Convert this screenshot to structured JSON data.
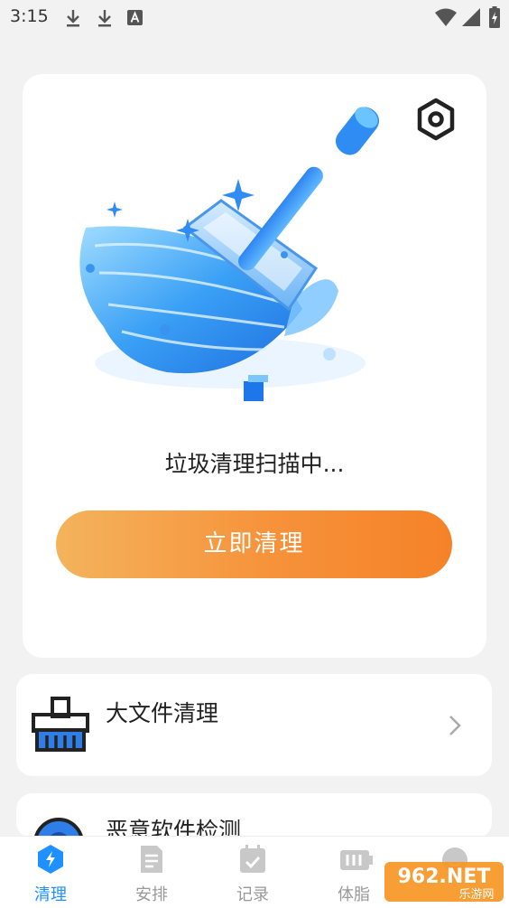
{
  "status_bar": {
    "time": "3:15"
  },
  "hero": {
    "scan_status": "垃圾清理扫描中...",
    "clean_button": "立即清理"
  },
  "features": [
    {
      "label": "大文件清理"
    },
    {
      "label": "恶意软件检测"
    }
  ],
  "bottom_nav": [
    {
      "label": "清理",
      "active": true
    },
    {
      "label": "安排",
      "active": false
    },
    {
      "label": "记录",
      "active": false
    },
    {
      "label": "体脂",
      "active": false
    },
    {
      "label": "",
      "active": false
    }
  ],
  "watermark": {
    "brand": "962.NET",
    "sub": "乐游网"
  },
  "colors": {
    "accent": "#1e90ff",
    "button_start": "#f4b35c",
    "button_end": "#f58228"
  }
}
